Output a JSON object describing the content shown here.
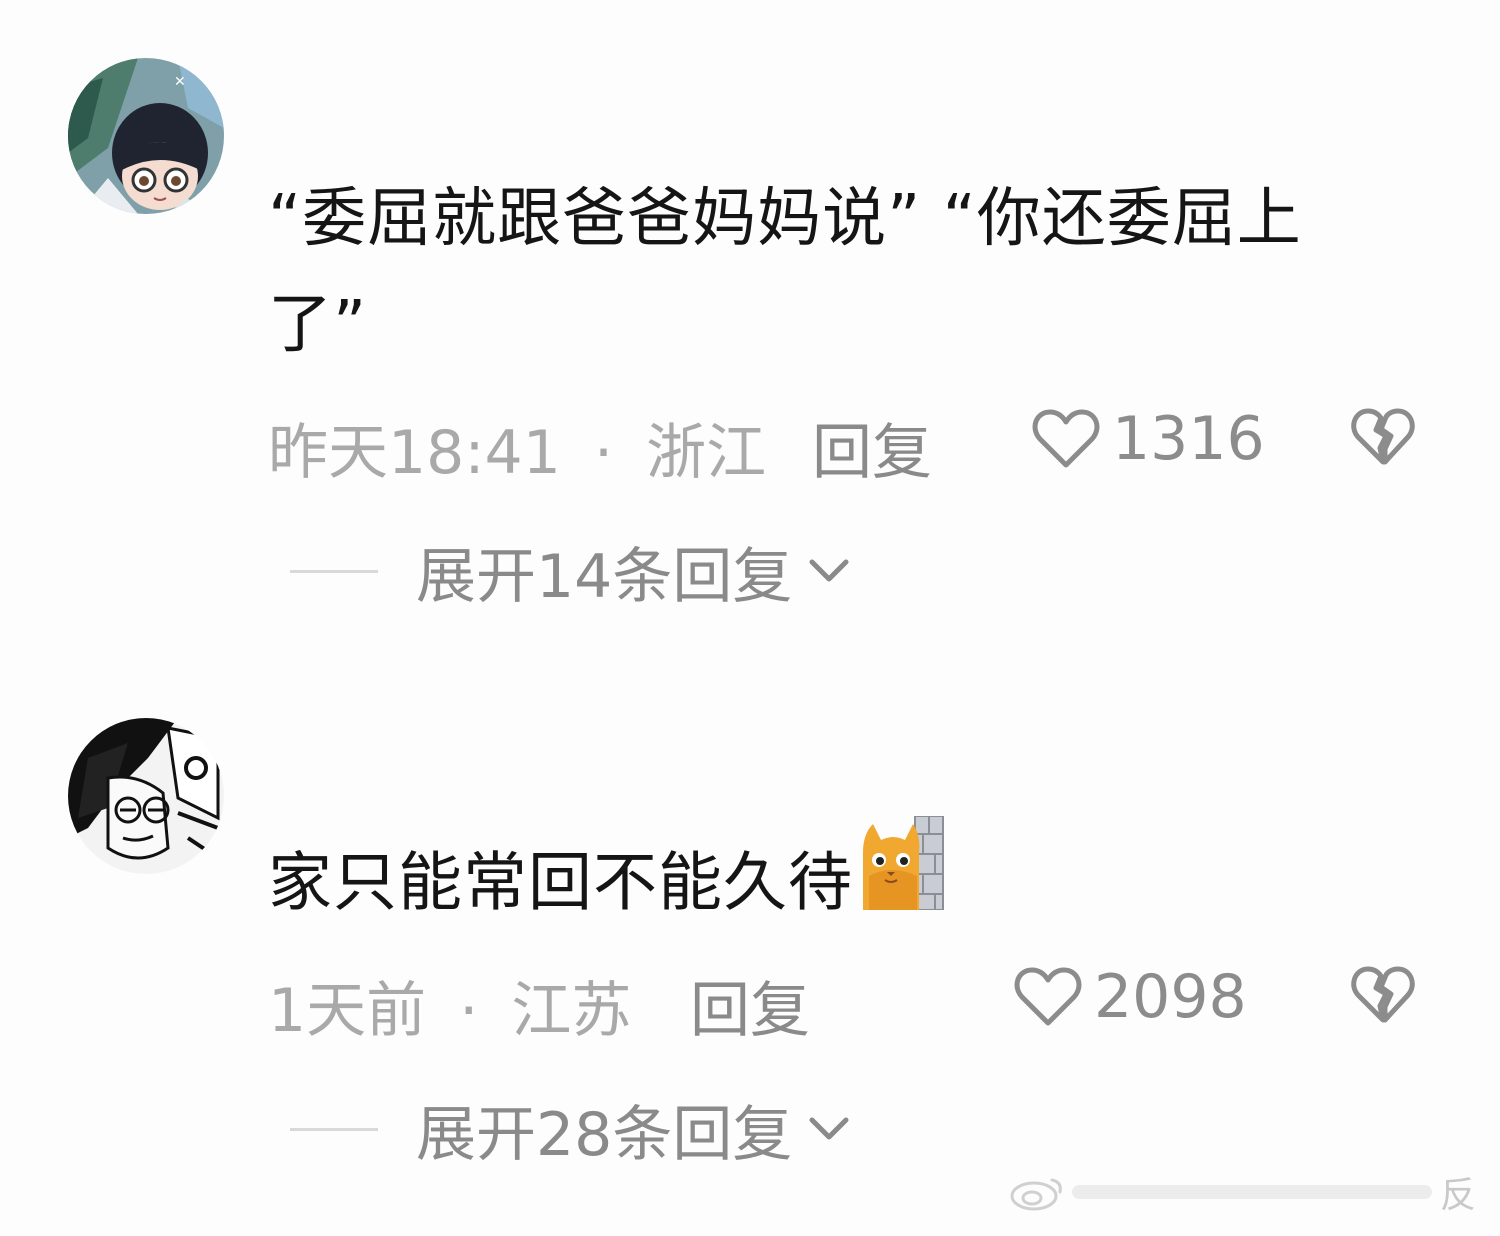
{
  "comments": [
    {
      "avatar_icon": "anime-avatar-glasses-icon",
      "text": "“委屈就跟爸爸妈妈说”  “你还委屈上了”",
      "time": "昨天18:41",
      "separator": "·",
      "location": "浙江",
      "reply_label": "回复",
      "likes": "1316",
      "expand_label": "展开14条回复"
    },
    {
      "avatar_icon": "manga-avatar-icon",
      "text": "家只能常回不能久待",
      "emoji": "cat-behind-wall-icon",
      "time": "1天前",
      "separator": "·",
      "location": "江苏",
      "reply_label": "回复",
      "likes": "2098",
      "expand_label": "展开28条回复"
    }
  ],
  "watermark": {
    "text": "反"
  },
  "colors": {
    "meta": "#a9a9a9",
    "action": "#8a8a8a",
    "text": "#151515",
    "background": "#fdfdfd"
  }
}
